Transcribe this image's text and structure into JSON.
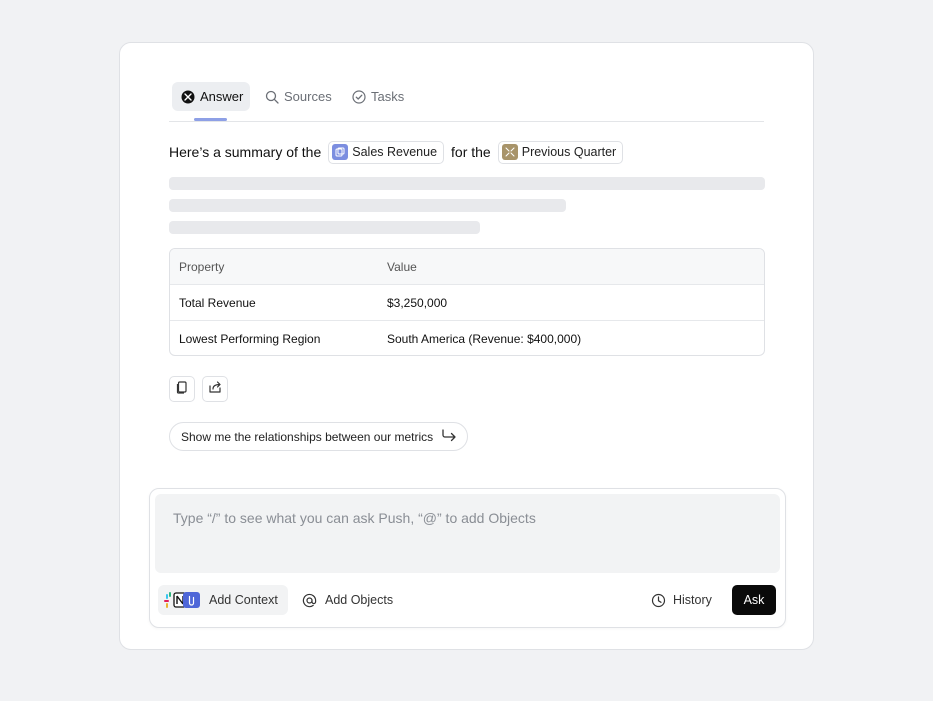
{
  "tabs": [
    {
      "label": "Answer",
      "icon": "answer-icon"
    },
    {
      "label": "Sources",
      "icon": "search-icon"
    },
    {
      "label": "Tasks",
      "icon": "check-circle-icon"
    }
  ],
  "summary": {
    "prefix": "Here’s a summary of the",
    "chip1": {
      "label": "Sales Revenue",
      "icon": "dataset-icon",
      "color": "#7c8ee0"
    },
    "middle": "for the",
    "chip2": {
      "label": "Previous Quarter",
      "icon": "calendar-icon",
      "color": "#a8946a"
    }
  },
  "table": {
    "headers": [
      "Property",
      "Value"
    ],
    "rows": [
      [
        "Total Revenue",
        "$3,250,000"
      ],
      [
        "Lowest Performing Region",
        "South America (Revenue: $400,000)"
      ]
    ]
  },
  "actions": [
    {
      "icon": "copy-icon"
    },
    {
      "icon": "share-icon"
    }
  ],
  "suggestion": {
    "label": "Show me the relationships between our metrics",
    "icon": "arrow-return-icon"
  },
  "composer": {
    "placeholder": "Type “/” to see what you can ask Push, “@” to add Objects",
    "add_context_label": "Add Context",
    "add_objects_label": "Add Objects",
    "history_label": "History",
    "ask_label": "Ask"
  },
  "colors": {
    "accent": "#8ea0e6",
    "ask_button": "#0a0a0a",
    "background": "#f1f2f4"
  }
}
